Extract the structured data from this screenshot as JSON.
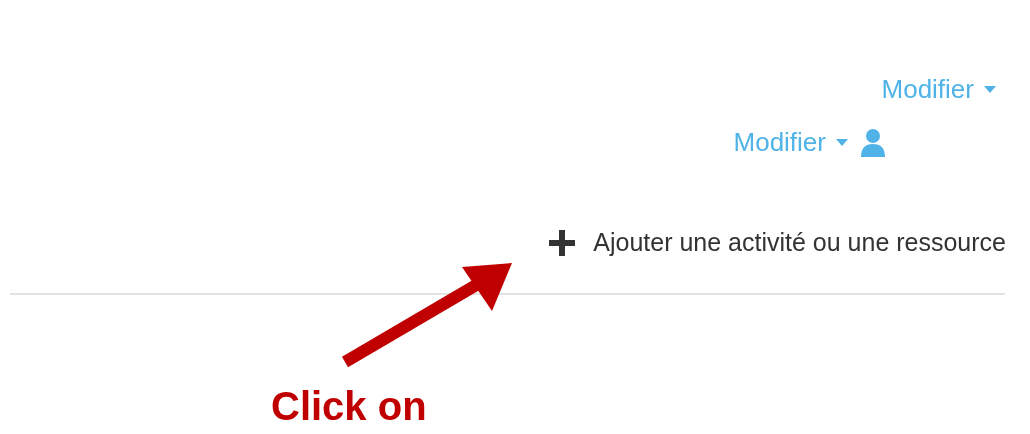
{
  "edit_menus": [
    {
      "label": "Modifier",
      "kind": "plain"
    },
    {
      "label": "Modifier",
      "kind": "user"
    }
  ],
  "add_action": {
    "label": "Ajouter une activité ou une ressource"
  },
  "annotation": {
    "text": "Click on"
  }
}
